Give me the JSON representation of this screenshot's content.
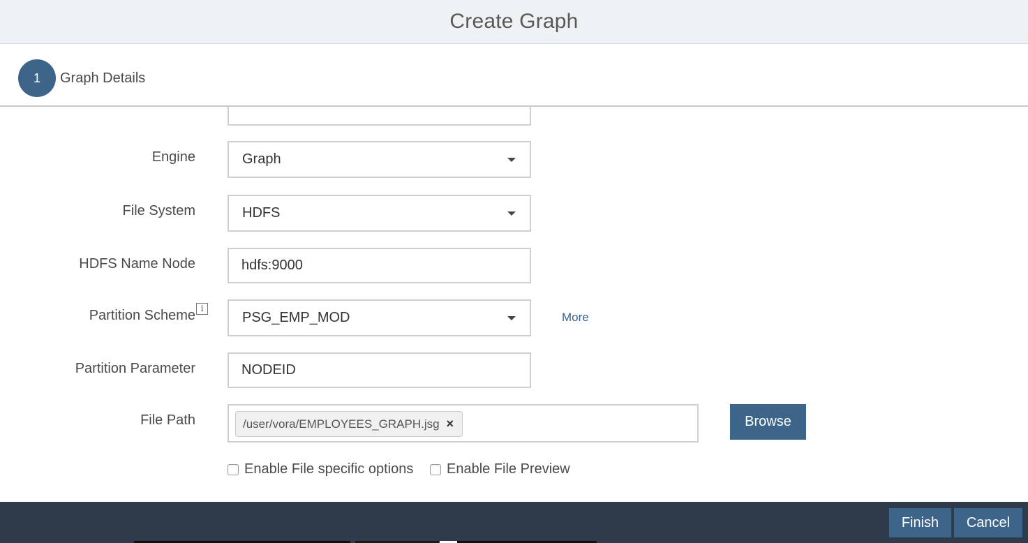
{
  "header": {
    "title": "Create Graph"
  },
  "steps": [
    {
      "number": "1",
      "label": "Graph Details"
    }
  ],
  "form": {
    "engine": {
      "label": "Engine",
      "value": "Graph"
    },
    "file_system": {
      "label": "File System",
      "value": "HDFS"
    },
    "hdfs_name_node": {
      "label": "HDFS Name Node",
      "value": "hdfs:9000"
    },
    "partition_scheme": {
      "label": "Partition Scheme",
      "value": "PSG_EMP_MOD",
      "info_glyph": "i",
      "more_link": "More"
    },
    "partition_parameter": {
      "label": "Partition Parameter",
      "value": "NODEID"
    },
    "file_path": {
      "label": "File Path",
      "chip": "/user/vora/EMPLOYEES_GRAPH.jsg",
      "chip_remove": "×",
      "browse_label": "Browse"
    },
    "enable_file_specific_options": {
      "label": "Enable File specific options",
      "checked": false
    },
    "enable_file_preview": {
      "label": "Enable File Preview",
      "checked": false
    }
  },
  "footer": {
    "finish_label": "Finish",
    "cancel_label": "Cancel"
  },
  "colors": {
    "accent": "#3d6489",
    "footer_bg": "#2e3b4a",
    "header_bg": "#eef2f5"
  },
  "icons": {
    "dropdown": "chevron-down-icon",
    "info": "info-icon",
    "remove": "close-icon"
  }
}
